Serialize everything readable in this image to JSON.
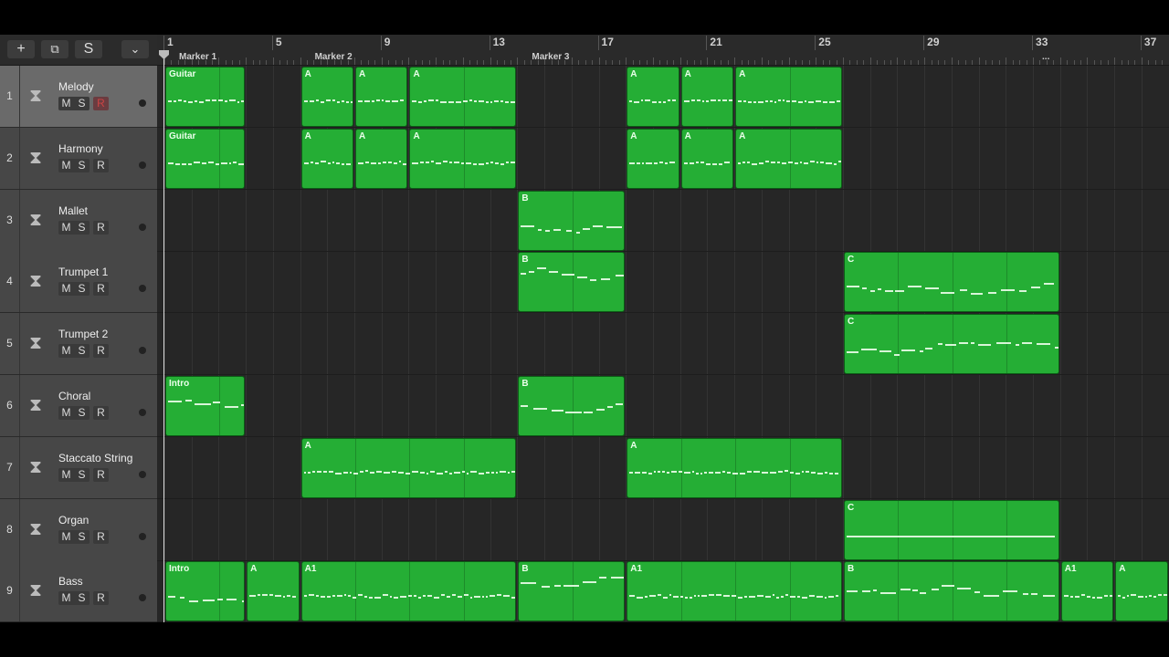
{
  "toolbar": {
    "add": "+",
    "duplicate": "⧉",
    "smart": "S",
    "collapse": "⌄"
  },
  "ruler": {
    "bars": [
      "1",
      "5",
      "9",
      "13",
      "17",
      "21",
      "25",
      "29",
      "33",
      "37"
    ],
    "markers": [
      {
        "label": "Marker 1",
        "bar": 1
      },
      {
        "label": "Marker 2",
        "bar": 6
      },
      {
        "label": "Marker 3",
        "bar": 14
      },
      {
        "label": "...",
        "bar": 33
      }
    ]
  },
  "track_buttons": {
    "mute": "M",
    "solo": "S",
    "record": "R"
  },
  "tracks": [
    {
      "num": "1",
      "name": "Melody",
      "selected": true,
      "record_armed": true,
      "regions": [
        {
          "label": "Guitar",
          "start": 1,
          "end": 4
        },
        {
          "label": "A",
          "start": 6,
          "end": 8
        },
        {
          "label": "A",
          "start": 8,
          "end": 10
        },
        {
          "label": "A",
          "start": 10,
          "end": 14
        },
        {
          "label": "A",
          "start": 18,
          "end": 20
        },
        {
          "label": "A",
          "start": 20,
          "end": 22
        },
        {
          "label": "A",
          "start": 22,
          "end": 26
        }
      ]
    },
    {
      "num": "2",
      "name": "Harmony",
      "regions": [
        {
          "label": "Guitar",
          "start": 1,
          "end": 4
        },
        {
          "label": "A",
          "start": 6,
          "end": 8
        },
        {
          "label": "A",
          "start": 8,
          "end": 10
        },
        {
          "label": "A",
          "start": 10,
          "end": 14
        },
        {
          "label": "A",
          "start": 18,
          "end": 20
        },
        {
          "label": "A",
          "start": 20,
          "end": 22
        },
        {
          "label": "A",
          "start": 22,
          "end": 26
        }
      ]
    },
    {
      "num": "3",
      "name": "Mallet",
      "regions": [
        {
          "label": "B",
          "start": 14,
          "end": 18
        }
      ]
    },
    {
      "num": "4",
      "name": "Trumpet 1",
      "regions": [
        {
          "label": "B",
          "start": 14,
          "end": 18
        },
        {
          "label": "C",
          "start": 26,
          "end": 34
        }
      ]
    },
    {
      "num": "5",
      "name": "Trumpet 2",
      "regions": [
        {
          "label": "C",
          "start": 26,
          "end": 34
        }
      ]
    },
    {
      "num": "6",
      "name": "Choral",
      "regions": [
        {
          "label": "Intro",
          "start": 1,
          "end": 4
        },
        {
          "label": "B",
          "start": 14,
          "end": 18
        }
      ]
    },
    {
      "num": "7",
      "name": "Staccato String",
      "regions": [
        {
          "label": "A",
          "start": 6,
          "end": 14
        },
        {
          "label": "A",
          "start": 18,
          "end": 26
        }
      ]
    },
    {
      "num": "8",
      "name": "Organ",
      "regions": [
        {
          "label": "C",
          "start": 26,
          "end": 34
        }
      ]
    },
    {
      "num": "9",
      "name": "Bass",
      "regions": [
        {
          "label": "Intro",
          "start": 1,
          "end": 4
        },
        {
          "label": "A",
          "start": 4,
          "end": 6
        },
        {
          "label": "A1",
          "start": 6,
          "end": 14
        },
        {
          "label": "B",
          "start": 14,
          "end": 18
        },
        {
          "label": "A1",
          "start": 18,
          "end": 26
        },
        {
          "label": "B",
          "start": 26,
          "end": 34
        },
        {
          "label": "A1",
          "start": 34,
          "end": 36
        },
        {
          "label": "A",
          "start": 36,
          "end": 38
        }
      ]
    }
  ],
  "colors": {
    "region": "#25ae35",
    "selected_track": "#6a6a6a",
    "track": "#474747"
  }
}
